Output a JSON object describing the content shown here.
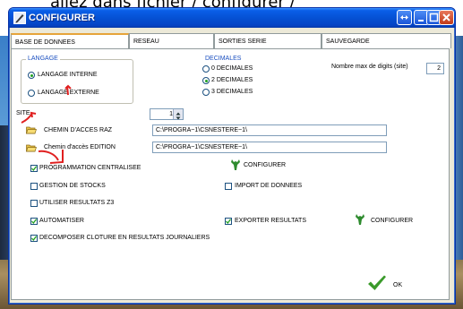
{
  "caption": "allez dans fichier / configurer /",
  "window": {
    "title": "CONFIGURER"
  },
  "tabs": [
    {
      "label": "BASE DE DONNEES",
      "active": true
    },
    {
      "label": "RESEAU",
      "active": false
    },
    {
      "label": "SORTIES SERIE",
      "active": false
    },
    {
      "label": "SAUVEGARDE",
      "active": false
    }
  ],
  "langage": {
    "title": "LANGAGE",
    "options": [
      {
        "label": "LANGAGE INTERNE",
        "selected": true
      },
      {
        "label": "LANGAGE EXTERNE",
        "selected": false
      }
    ]
  },
  "decimales": {
    "title": "DECIMALES",
    "options": [
      {
        "label": "0 DECIMALES",
        "selected": false
      },
      {
        "label": "2 DECIMALES",
        "selected": true
      },
      {
        "label": "3 DECIMALES",
        "selected": false
      }
    ]
  },
  "max_digits": {
    "label": "Nombre max de digits (site)",
    "value": "2"
  },
  "site": {
    "label": "SITE",
    "value": "1"
  },
  "chemin_raz": {
    "label": "CHEMIN D'ACCES RAZ",
    "value": "C:\\PROGRA~1\\CSNESTERE~1\\"
  },
  "chemin_edition": {
    "label": "Chemin d'accès EDITION",
    "value": "C:\\PROGRA~1\\CSNESTERE~1\\"
  },
  "checks": {
    "programmation": {
      "label": "PROGRAMMATION CENTRALISEE",
      "checked": true
    },
    "gestion_stocks": {
      "label": "GESTION DE STOCKS",
      "checked": false
    },
    "import_donnees": {
      "label": "IMPORT DE DONNEES",
      "checked": false
    },
    "resultats_z3": {
      "label": "UTILISER RESULTATS Z3",
      "checked": false
    },
    "automatiser": {
      "label": "AUTOMATISER",
      "checked": true
    },
    "exporter": {
      "label": "EXPORTER RESULTATS",
      "checked": true
    },
    "decomposer": {
      "label": "DECOMPOSER CLOTURE EN RESULTATS JOURNALIERS",
      "checked": true
    }
  },
  "configurer_1": "CONFIGURER",
  "configurer_2": "CONFIGURER",
  "ok_label": "OK",
  "colors": {
    "title_bar": "#0551d4",
    "accent_green": "#3a9a2a",
    "annotation_red": "#e02020"
  }
}
